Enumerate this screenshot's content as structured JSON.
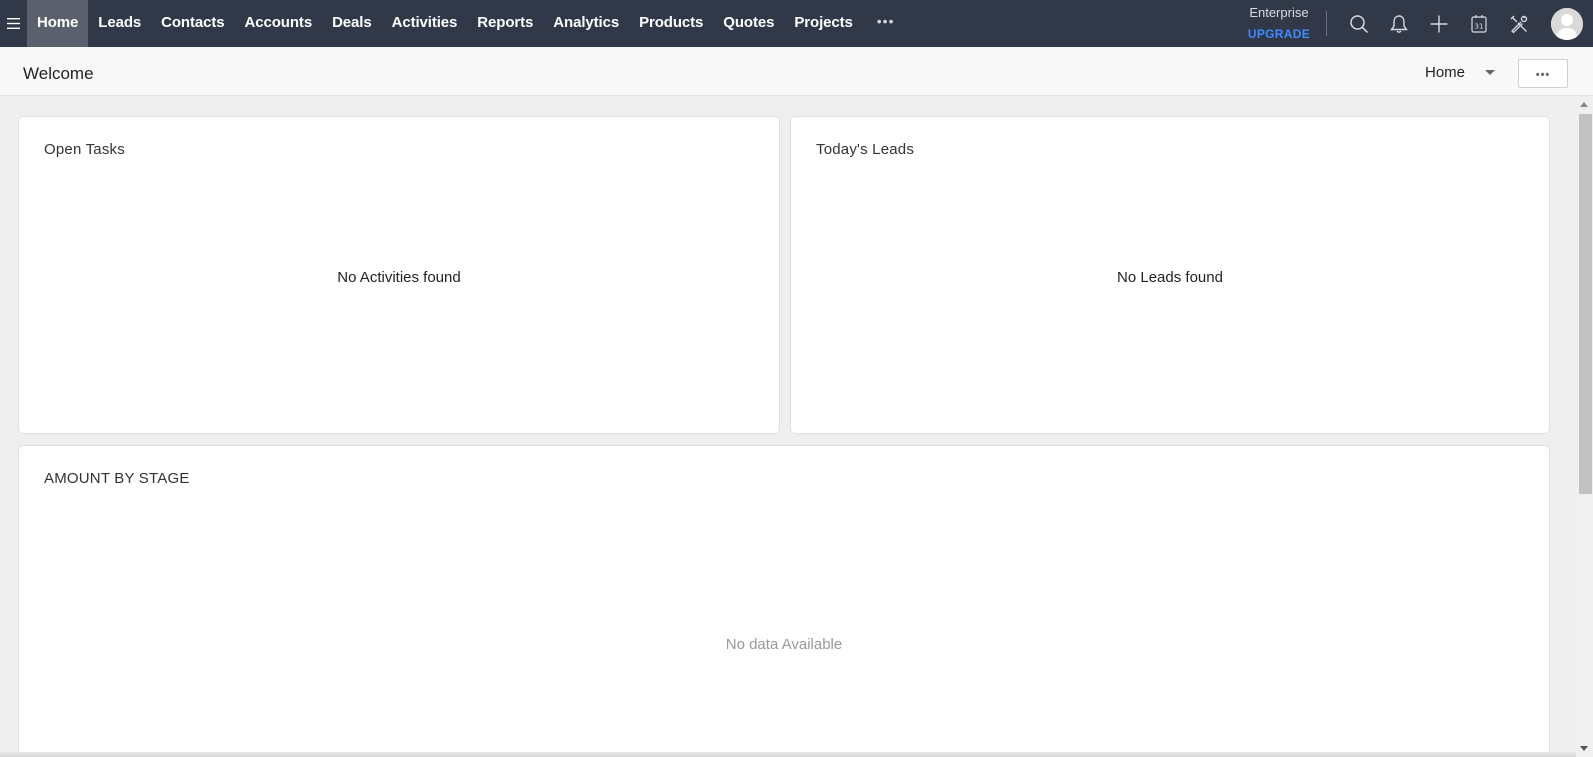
{
  "nav": {
    "menu_icon": "hamburger-menu-icon",
    "tabs": [
      {
        "label": "Home",
        "active": true
      },
      {
        "label": "Leads",
        "active": false
      },
      {
        "label": "Contacts",
        "active": false
      },
      {
        "label": "Accounts",
        "active": false
      },
      {
        "label": "Deals",
        "active": false
      },
      {
        "label": "Activities",
        "active": false
      },
      {
        "label": "Reports",
        "active": false
      },
      {
        "label": "Analytics",
        "active": false
      },
      {
        "label": "Products",
        "active": false
      },
      {
        "label": "Quotes",
        "active": false
      },
      {
        "label": "Projects",
        "active": false
      }
    ],
    "more_label": "•••",
    "edition": "Enterprise",
    "upgrade_label": "UPGRADE",
    "icons": [
      "search-icon",
      "bell-icon",
      "plus-icon",
      "calendar-icon",
      "tools-icon",
      "avatar-icon"
    ],
    "calendar_day": "31",
    "colors": {
      "bar": "#313949",
      "active_tab": "#5b616c",
      "upgrade": "#3e8bff"
    }
  },
  "subheader": {
    "title": "Welcome",
    "home_select": "Home",
    "more_label": "•••"
  },
  "cards": {
    "open_tasks": {
      "title": "Open Tasks",
      "empty_text": "No Activities found"
    },
    "todays_leads": {
      "title": "Today's Leads",
      "empty_text": "No Leads found"
    },
    "amount_by_stage": {
      "title": "AMOUNT BY STAGE",
      "empty_text": "No data Available"
    }
  }
}
